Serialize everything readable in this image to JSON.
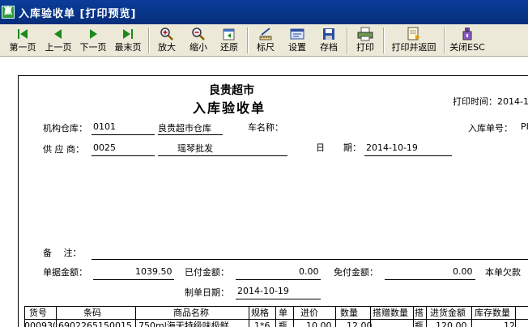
{
  "window": {
    "title": "入库验收单 [打印预览]",
    "app_icon": "赢"
  },
  "toolbar": [
    {
      "name": "first-page-button",
      "icon": "first-page-icon",
      "label": "第一页"
    },
    {
      "name": "prev-page-button",
      "icon": "prev-page-icon",
      "label": "上一页"
    },
    {
      "name": "next-page-button",
      "icon": "next-page-icon",
      "label": "下一页"
    },
    {
      "name": "last-page-button",
      "icon": "last-page-icon",
      "label": "最末页"
    },
    {
      "name": "zoom-in-button",
      "icon": "zoom-in-icon",
      "label": "放大"
    },
    {
      "name": "zoom-out-button",
      "icon": "zoom-out-icon",
      "label": "缩小"
    },
    {
      "name": "restore-button",
      "icon": "restore-icon",
      "label": "还原"
    },
    {
      "name": "ruler-button",
      "icon": "ruler-icon",
      "label": "标尺"
    },
    {
      "name": "settings-button",
      "icon": "settings-icon",
      "label": "设置"
    },
    {
      "name": "save-button",
      "icon": "floppy-icon",
      "label": "存档"
    },
    {
      "name": "print-button",
      "icon": "printer-icon",
      "label": "打印"
    },
    {
      "name": "print-return-button",
      "icon": "print-return-icon",
      "label": "打印并返回"
    },
    {
      "name": "close-button",
      "icon": "close-esc-icon",
      "label": "关闭ESC"
    }
  ],
  "doc": {
    "company": "良贵超市",
    "doc_title": "入库验收单",
    "print_time_label": "打印时间：2014-1",
    "warehouse_label": "机构仓库：",
    "warehouse_code": "0101",
    "warehouse_name": "良贵超市仓库",
    "car_label": "车名称：",
    "inbound_no_label": "入库单号：",
    "inbound_no_value": "PI",
    "supplier_label": "供 应 商：",
    "supplier_code": "0025",
    "supplier_name": "瑶琴批发",
    "date_label_1": "日",
    "date_label_2": "期：",
    "date_value": "2014-10-19",
    "remark_label": "备　 注：",
    "amount_label": "单据金额：",
    "amount_value": "1039.50",
    "paid_label": "已付金额：",
    "paid_value": "0.00",
    "free_label": "免付金额：",
    "free_value": "0.00",
    "owed_label": "本单欠款",
    "made_date_label": "制单日期：",
    "made_date_value": "2014-10-19"
  },
  "table": {
    "headers": [
      "货号",
      "条码",
      "商品名称",
      "规格",
      "单",
      "进价",
      "数量",
      "搭赠数量",
      "搭",
      "进货金额",
      "库存数量"
    ],
    "rows": [
      [
        "000930",
        "6902265150015",
        "750ml海天特级味极鲜",
        "1*6",
        "瓶",
        "10.00",
        "12.00",
        "",
        "瓶",
        "120.00",
        "12"
      ]
    ]
  }
}
